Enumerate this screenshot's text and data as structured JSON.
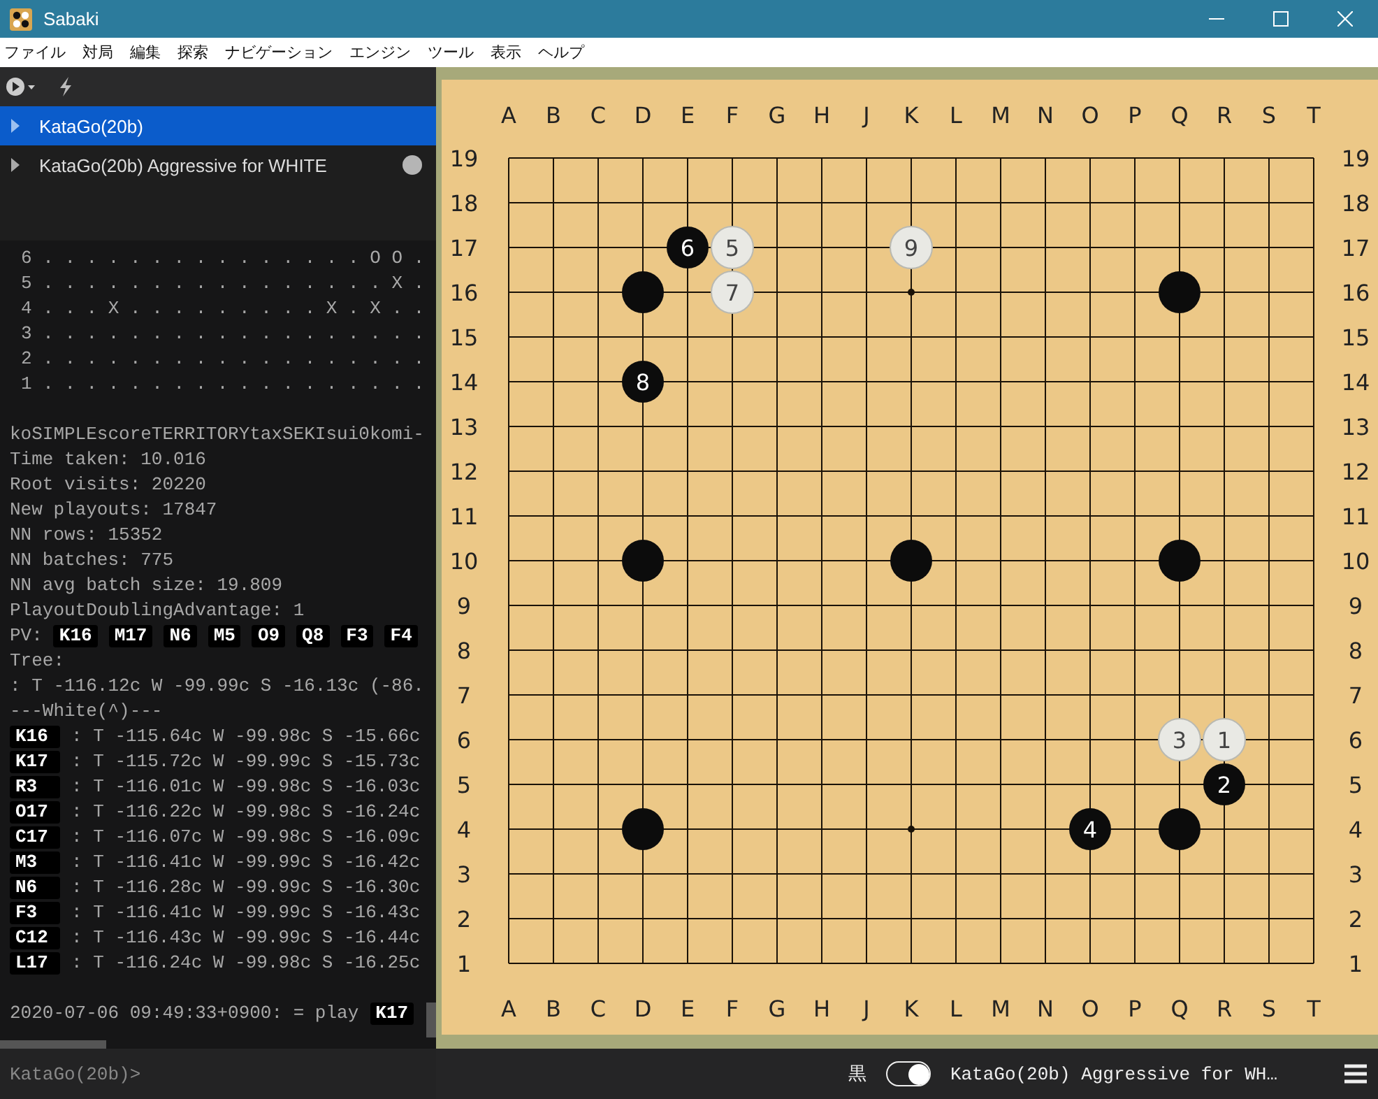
{
  "window": {
    "title": "Sabaki"
  },
  "menu": [
    "ファイル",
    "対局",
    "編集",
    "探索",
    "ナビゲーション",
    "エンジン",
    "ツール",
    "表示",
    "ヘルプ"
  ],
  "engines": [
    {
      "name": "KataGo(20b)",
      "selected": true,
      "busy": false
    },
    {
      "name": "KataGo(20b) Aggressive for WHITE",
      "selected": false,
      "busy": true
    }
  ],
  "console": [
    {
      "kind": "board",
      "text": "6 . . . . . . . . . . . . . . . O O ."
    },
    {
      "kind": "board",
      "text": "5 . . . . . . . . . . . . . . . . X ."
    },
    {
      "kind": "board",
      "text": "4 . . . X . . . . . . . . . X . X . ."
    },
    {
      "kind": "board",
      "text": "3 . . . . . . . . . . . . . . . . . ."
    },
    {
      "kind": "board",
      "text": "2 . . . . . . . . . . . . . . . . . ."
    },
    {
      "kind": "board",
      "text": "1 . . . . . . . . . . . . . . . . . ."
    },
    {
      "kind": "gap"
    },
    {
      "kind": "text",
      "text": "koSIMPLEscoreTERRITORYtaxSEKIsui0komi-"
    },
    {
      "kind": "text",
      "text": "Time taken: 10.016"
    },
    {
      "kind": "text",
      "text": "Root visits: 20220"
    },
    {
      "kind": "text",
      "text": "New playouts: 17847"
    },
    {
      "kind": "text",
      "text": "NN rows: 15352"
    },
    {
      "kind": "text",
      "text": "NN batches: 775"
    },
    {
      "kind": "text",
      "text": "NN avg batch size: 19.809"
    },
    {
      "kind": "text",
      "text": "PlayoutDoublingAdvantage: 1"
    },
    {
      "kind": "pv",
      "text": "PV:",
      "moves": [
        "K16",
        "M17",
        "N6",
        "M5",
        "O9",
        "Q8",
        "F3",
        "F4"
      ]
    },
    {
      "kind": "text",
      "text": "Tree:"
    },
    {
      "kind": "text",
      "text": ": T -116.12c W -99.99c S -16.13c (-86."
    },
    {
      "kind": "text",
      "text": "---White(^)---"
    },
    {
      "kind": "move",
      "move": "K16",
      "text": ": T -115.64c W -99.98c S -15.66c"
    },
    {
      "kind": "move",
      "move": "K17",
      "text": ": T -115.72c W -99.99c S -15.73c"
    },
    {
      "kind": "move",
      "move": "R3",
      "text": ": T -116.01c W -99.98c S -16.03c"
    },
    {
      "kind": "move",
      "move": "O17",
      "text": ": T -116.22c W -99.98c S -16.24c"
    },
    {
      "kind": "move",
      "move": "C17",
      "text": ": T -116.07c W -99.98c S -16.09c"
    },
    {
      "kind": "move",
      "move": "M3",
      "text": ": T -116.41c W -99.99c S -16.42c"
    },
    {
      "kind": "move",
      "move": "N6",
      "text": ": T -116.28c W -99.99c S -16.30c"
    },
    {
      "kind": "move",
      "move": "F3",
      "text": ": T -116.41c W -99.99c S -16.43c"
    },
    {
      "kind": "move",
      "move": "C12",
      "text": ": T -116.43c W -99.99c S -16.44c"
    },
    {
      "kind": "move",
      "move": "L17",
      "text": ": T -116.24c W -99.98c S -16.25c"
    },
    {
      "kind": "gap"
    },
    {
      "kind": "play",
      "text": "2020-07-06 09:49:33+0900: = play",
      "move": "K17"
    }
  ],
  "command_input": {
    "placeholder": "KataGo(20b)>"
  },
  "board": {
    "top_labels": [
      "A",
      "B",
      "C",
      "D",
      "E",
      "F",
      "G",
      "H",
      "J",
      "K",
      "L",
      "M",
      "N",
      "O",
      "P",
      "Q",
      "R",
      "S",
      "T"
    ],
    "bottom_labels": [
      "A",
      "B",
      "C",
      "D",
      "E",
      "F",
      "G",
      "H",
      "J",
      "K",
      "L",
      "M",
      "N",
      "O",
      "P",
      "Q",
      "R",
      "S",
      "T"
    ],
    "left_labels": [
      "19",
      "18",
      "17",
      "16",
      "15",
      "14",
      "13",
      "12",
      "11",
      "10",
      "9",
      "8",
      "7",
      "6",
      "5",
      "4",
      "3",
      "2",
      "1"
    ],
    "right_labels": [
      "19",
      "18",
      "17",
      "16",
      "15",
      "14",
      "13",
      "12",
      "11",
      "10",
      "9",
      "8",
      "7",
      "6",
      "5",
      "4",
      "3",
      "2",
      "1"
    ],
    "grid": [
      {
        "points": [
          {
            "occupied": false
          },
          {
            "occupied": false
          },
          {
            "occupied": false
          },
          {
            "occupied": false
          },
          {
            "occupied": false
          },
          {
            "occupied": false
          },
          {
            "occupied": false
          },
          {
            "occupied": false
          },
          {
            "occupied": false
          },
          {
            "occupied": false
          },
          {
            "occupied": false
          },
          {
            "occupied": false
          },
          {
            "occupied": false
          },
          {
            "occupied": false
          },
          {
            "occupied": false
          },
          {
            "occupied": false
          },
          {
            "occupied": false
          },
          {
            "occupied": false
          },
          {
            "occupied": false
          }
        ]
      },
      {
        "points": [
          {
            "occupied": false
          },
          {
            "occupied": false
          },
          {
            "occupied": false
          },
          {
            "occupied": false
          },
          {
            "occupied": false
          },
          {
            "occupied": false
          },
          {
            "occupied": false
          },
          {
            "occupied": false
          },
          {
            "occupied": false
          },
          {
            "occupied": false
          },
          {
            "occupied": false
          },
          {
            "occupied": false
          },
          {
            "occupied": false
          },
          {
            "occupied": false
          },
          {
            "occupied": false
          },
          {
            "occupied": false
          },
          {
            "occupied": false
          },
          {
            "occupied": false
          },
          {
            "occupied": false
          }
        ]
      },
      {
        "points": [
          {
            "occupied": false
          },
          {
            "occupied": false
          },
          {
            "occupied": false
          },
          {
            "occupied": false
          },
          {
            "occupied": true,
            "black": true,
            "number": "6"
          },
          {
            "occupied": true,
            "black": false,
            "number": "5"
          },
          {
            "occupied": false
          },
          {
            "occupied": false
          },
          {
            "occupied": false
          },
          {
            "occupied": true,
            "black": false,
            "number": "9"
          },
          {
            "occupied": false
          },
          {
            "occupied": false
          },
          {
            "occupied": false
          },
          {
            "occupied": false
          },
          {
            "occupied": false
          },
          {
            "occupied": false
          },
          {
            "occupied": false
          },
          {
            "occupied": false
          },
          {
            "occupied": false
          }
        ]
      },
      {
        "points": [
          {
            "occupied": false
          },
          {
            "occupied": false
          },
          {
            "occupied": false
          },
          {
            "occupied": true,
            "black": true
          },
          {
            "occupied": false
          },
          {
            "occupied": true,
            "black": false,
            "number": "7"
          },
          {
            "occupied": false
          },
          {
            "occupied": false
          },
          {
            "occupied": false
          },
          {
            "occupied": false
          },
          {
            "occupied": false
          },
          {
            "occupied": false
          },
          {
            "occupied": false
          },
          {
            "occupied": false
          },
          {
            "occupied": false
          },
          {
            "occupied": true,
            "black": true
          },
          {
            "occupied": false
          },
          {
            "occupied": false
          },
          {
            "occupied": false
          }
        ]
      },
      {
        "points": [
          {
            "occupied": false
          },
          {
            "occupied": false
          },
          {
            "occupied": false
          },
          {
            "occupied": false
          },
          {
            "occupied": false
          },
          {
            "occupied": false
          },
          {
            "occupied": false
          },
          {
            "occupied": false
          },
          {
            "occupied": false
          },
          {
            "occupied": false
          },
          {
            "occupied": false
          },
          {
            "occupied": false
          },
          {
            "occupied": false
          },
          {
            "occupied": false
          },
          {
            "occupied": false
          },
          {
            "occupied": false
          },
          {
            "occupied": false
          },
          {
            "occupied": false
          },
          {
            "occupied": false
          }
        ]
      },
      {
        "points": [
          {
            "occupied": false
          },
          {
            "occupied": false
          },
          {
            "occupied": false
          },
          {
            "occupied": true,
            "black": true,
            "number": "8"
          },
          {
            "occupied": false
          },
          {
            "occupied": false
          },
          {
            "occupied": false
          },
          {
            "occupied": false
          },
          {
            "occupied": false
          },
          {
            "occupied": false
          },
          {
            "occupied": false
          },
          {
            "occupied": false
          },
          {
            "occupied": false
          },
          {
            "occupied": false
          },
          {
            "occupied": false
          },
          {
            "occupied": false
          },
          {
            "occupied": false
          },
          {
            "occupied": false
          },
          {
            "occupied": false
          }
        ]
      },
      {
        "points": [
          {
            "occupied": false
          },
          {
            "occupied": false
          },
          {
            "occupied": false
          },
          {
            "occupied": false
          },
          {
            "occupied": false
          },
          {
            "occupied": false
          },
          {
            "occupied": false
          },
          {
            "occupied": false
          },
          {
            "occupied": false
          },
          {
            "occupied": false
          },
          {
            "occupied": false
          },
          {
            "occupied": false
          },
          {
            "occupied": false
          },
          {
            "occupied": false
          },
          {
            "occupied": false
          },
          {
            "occupied": false
          },
          {
            "occupied": false
          },
          {
            "occupied": false
          },
          {
            "occupied": false
          }
        ]
      },
      {
        "points": [
          {
            "occupied": false
          },
          {
            "occupied": false
          },
          {
            "occupied": false
          },
          {
            "occupied": false
          },
          {
            "occupied": false
          },
          {
            "occupied": false
          },
          {
            "occupied": false
          },
          {
            "occupied": false
          },
          {
            "occupied": false
          },
          {
            "occupied": false
          },
          {
            "occupied": false
          },
          {
            "occupied": false
          },
          {
            "occupied": false
          },
          {
            "occupied": false
          },
          {
            "occupied": false
          },
          {
            "occupied": false
          },
          {
            "occupied": false
          },
          {
            "occupied": false
          },
          {
            "occupied": false
          }
        ]
      },
      {
        "points": [
          {
            "occupied": false
          },
          {
            "occupied": false
          },
          {
            "occupied": false
          },
          {
            "occupied": false
          },
          {
            "occupied": false
          },
          {
            "occupied": false
          },
          {
            "occupied": false
          },
          {
            "occupied": false
          },
          {
            "occupied": false
          },
          {
            "occupied": false
          },
          {
            "occupied": false
          },
          {
            "occupied": false
          },
          {
            "occupied": false
          },
          {
            "occupied": false
          },
          {
            "occupied": false
          },
          {
            "occupied": false
          },
          {
            "occupied": false
          },
          {
            "occupied": false
          },
          {
            "occupied": false
          }
        ]
      },
      {
        "points": [
          {
            "occupied": false
          },
          {
            "occupied": false
          },
          {
            "occupied": false
          },
          {
            "occupied": true,
            "black": true
          },
          {
            "occupied": false
          },
          {
            "occupied": false
          },
          {
            "occupied": false
          },
          {
            "occupied": false
          },
          {
            "occupied": false
          },
          {
            "occupied": true,
            "black": true
          },
          {
            "occupied": false
          },
          {
            "occupied": false
          },
          {
            "occupied": false
          },
          {
            "occupied": false
          },
          {
            "occupied": false
          },
          {
            "occupied": true,
            "black": true
          },
          {
            "occupied": false
          },
          {
            "occupied": false
          },
          {
            "occupied": false
          }
        ]
      },
      {
        "points": [
          {
            "occupied": false
          },
          {
            "occupied": false
          },
          {
            "occupied": false
          },
          {
            "occupied": false
          },
          {
            "occupied": false
          },
          {
            "occupied": false
          },
          {
            "occupied": false
          },
          {
            "occupied": false
          },
          {
            "occupied": false
          },
          {
            "occupied": false
          },
          {
            "occupied": false
          },
          {
            "occupied": false
          },
          {
            "occupied": false
          },
          {
            "occupied": false
          },
          {
            "occupied": false
          },
          {
            "occupied": false
          },
          {
            "occupied": false
          },
          {
            "occupied": false
          },
          {
            "occupied": false
          }
        ]
      },
      {
        "points": [
          {
            "occupied": false
          },
          {
            "occupied": false
          },
          {
            "occupied": false
          },
          {
            "occupied": false
          },
          {
            "occupied": false
          },
          {
            "occupied": false
          },
          {
            "occupied": false
          },
          {
            "occupied": false
          },
          {
            "occupied": false
          },
          {
            "occupied": false
          },
          {
            "occupied": false
          },
          {
            "occupied": false
          },
          {
            "occupied": false
          },
          {
            "occupied": false
          },
          {
            "occupied": false
          },
          {
            "occupied": false
          },
          {
            "occupied": false
          },
          {
            "occupied": false
          },
          {
            "occupied": false
          }
        ]
      },
      {
        "points": [
          {
            "occupied": false
          },
          {
            "occupied": false
          },
          {
            "occupied": false
          },
          {
            "occupied": false
          },
          {
            "occupied": false
          },
          {
            "occupied": false
          },
          {
            "occupied": false
          },
          {
            "occupied": false
          },
          {
            "occupied": false
          },
          {
            "occupied": false
          },
          {
            "occupied": false
          },
          {
            "occupied": false
          },
          {
            "occupied": false
          },
          {
            "occupied": false
          },
          {
            "occupied": false
          },
          {
            "occupied": false
          },
          {
            "occupied": false
          },
          {
            "occupied": false
          },
          {
            "occupied": false
          }
        ]
      },
      {
        "points": [
          {
            "occupied": false
          },
          {
            "occupied": false
          },
          {
            "occupied": false
          },
          {
            "occupied": false
          },
          {
            "occupied": false
          },
          {
            "occupied": false
          },
          {
            "occupied": false
          },
          {
            "occupied": false
          },
          {
            "occupied": false
          },
          {
            "occupied": false
          },
          {
            "occupied": false
          },
          {
            "occupied": false
          },
          {
            "occupied": false
          },
          {
            "occupied": false
          },
          {
            "occupied": false
          },
          {
            "occupied": true,
            "black": false,
            "number": "3"
          },
          {
            "occupied": true,
            "black": false,
            "number": "1"
          },
          {
            "occupied": false
          },
          {
            "occupied": false
          }
        ]
      },
      {
        "points": [
          {
            "occupied": false
          },
          {
            "occupied": false
          },
          {
            "occupied": false
          },
          {
            "occupied": false
          },
          {
            "occupied": false
          },
          {
            "occupied": false
          },
          {
            "occupied": false
          },
          {
            "occupied": false
          },
          {
            "occupied": false
          },
          {
            "occupied": false
          },
          {
            "occupied": false
          },
          {
            "occupied": false
          },
          {
            "occupied": false
          },
          {
            "occupied": false
          },
          {
            "occupied": false
          },
          {
            "occupied": false
          },
          {
            "occupied": true,
            "black": true,
            "number": "2"
          },
          {
            "occupied": false
          },
          {
            "occupied": false
          }
        ]
      },
      {
        "points": [
          {
            "occupied": false
          },
          {
            "occupied": false
          },
          {
            "occupied": false
          },
          {
            "occupied": true,
            "black": true
          },
          {
            "occupied": false
          },
          {
            "occupied": false
          },
          {
            "occupied": false
          },
          {
            "occupied": false
          },
          {
            "occupied": false
          },
          {
            "occupied": false
          },
          {
            "occupied": false
          },
          {
            "occupied": false
          },
          {
            "occupied": false
          },
          {
            "occupied": true,
            "black": true,
            "number": "4"
          },
          {
            "occupied": false
          },
          {
            "occupied": true,
            "black": true
          },
          {
            "occupied": false
          },
          {
            "occupied": false
          },
          {
            "occupied": false
          }
        ]
      },
      {
        "points": [
          {
            "occupied": false
          },
          {
            "occupied": false
          },
          {
            "occupied": false
          },
          {
            "occupied": false
          },
          {
            "occupied": false
          },
          {
            "occupied": false
          },
          {
            "occupied": false
          },
          {
            "occupied": false
          },
          {
            "occupied": false
          },
          {
            "occupied": false
          },
          {
            "occupied": false
          },
          {
            "occupied": false
          },
          {
            "occupied": false
          },
          {
            "occupied": false
          },
          {
            "occupied": false
          },
          {
            "occupied": false
          },
          {
            "occupied": false
          },
          {
            "occupied": false
          },
          {
            "occupied": false
          }
        ]
      },
      {
        "points": [
          {
            "occupied": false
          },
          {
            "occupied": false
          },
          {
            "occupied": false
          },
          {
            "occupied": false
          },
          {
            "occupied": false
          },
          {
            "occupied": false
          },
          {
            "occupied": false
          },
          {
            "occupied": false
          },
          {
            "occupied": false
          },
          {
            "occupied": false
          },
          {
            "occupied": false
          },
          {
            "occupied": false
          },
          {
            "occupied": false
          },
          {
            "occupied": false
          },
          {
            "occupied": false
          },
          {
            "occupied": false
          },
          {
            "occupied": false
          },
          {
            "occupied": false
          },
          {
            "occupied": false
          }
        ]
      },
      {
        "points": [
          {
            "occupied": false
          },
          {
            "occupied": false
          },
          {
            "occupied": false
          },
          {
            "occupied": false
          },
          {
            "occupied": false
          },
          {
            "occupied": false
          },
          {
            "occupied": false
          },
          {
            "occupied": false
          },
          {
            "occupied": false
          },
          {
            "occupied": false
          },
          {
            "occupied": false
          },
          {
            "occupied": false
          },
          {
            "occupied": false
          },
          {
            "occupied": false
          },
          {
            "occupied": false
          },
          {
            "occupied": false
          },
          {
            "occupied": false
          },
          {
            "occupied": false
          },
          {
            "occupied": false
          }
        ]
      }
    ]
  },
  "status_bar": {
    "player": "黒",
    "toggle_on": true,
    "engine": "KataGo(20b) Aggressive for WH…"
  }
}
